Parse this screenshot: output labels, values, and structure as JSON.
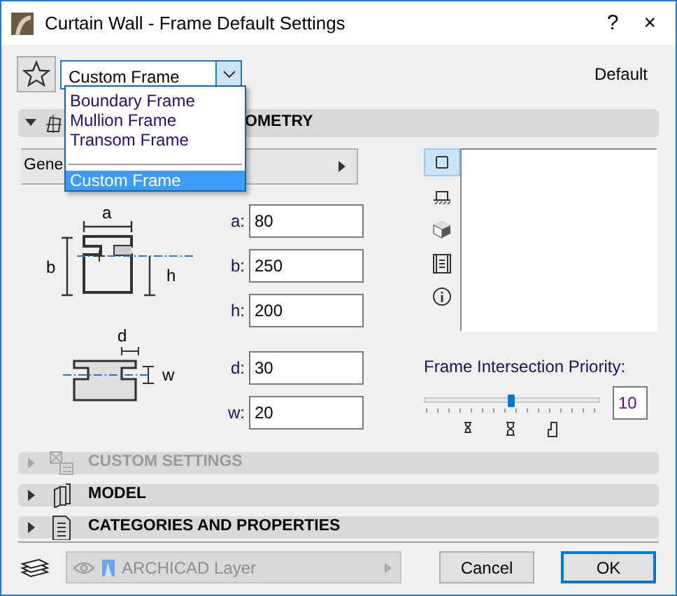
{
  "window": {
    "title": "Curtain Wall - Frame Default Settings",
    "help": "?",
    "close": "×"
  },
  "frame_type": {
    "value": "Custom Frame",
    "expanded": true,
    "options": [
      {
        "kind": "option",
        "label": "Boundary Frame",
        "selected": false
      },
      {
        "kind": "option",
        "label": "Mullion Frame",
        "selected": false
      },
      {
        "kind": "option",
        "label": "Transom Frame",
        "selected": false
      },
      {
        "kind": "separator"
      },
      {
        "kind": "option",
        "label": "Custom Frame",
        "selected": true
      }
    ]
  },
  "default_label": "Default",
  "sections": [
    {
      "kind": "geometry",
      "title": "OMETRY",
      "expanded": true,
      "disabled": false
    },
    {
      "kind": "custom",
      "title": "CUSTOM SETTINGS",
      "expanded": false,
      "disabled": true
    },
    {
      "kind": "model",
      "title": "MODEL",
      "expanded": false,
      "disabled": false
    },
    {
      "kind": "categories",
      "title": "CATEGORIES AND PROPERTIES",
      "expanded": false,
      "disabled": false
    }
  ],
  "geometry": {
    "profile_menu": "Gene",
    "diagram_labels": [
      "a",
      "b",
      "h",
      "d",
      "w"
    ],
    "fields": [
      {
        "label": "a:",
        "value": "80"
      },
      {
        "label": "b:",
        "value": "250"
      },
      {
        "label": "h:",
        "value": "200"
      },
      {
        "label": "d:",
        "value": "30"
      },
      {
        "label": "w:",
        "value": "20"
      }
    ],
    "view_tabs": [
      {
        "kind": "plan",
        "selected": true
      },
      {
        "kind": "section",
        "selected": false
      },
      {
        "kind": "cube",
        "selected": false
      },
      {
        "kind": "film",
        "selected": false
      },
      {
        "kind": "info",
        "selected": false
      }
    ],
    "priority": {
      "label": "Frame Intersection Priority:",
      "level": 0.5,
      "value": "10"
    }
  },
  "layer": {
    "value": "ARCHICAD Layer",
    "disabled": true
  },
  "buttons": [
    {
      "label": "Cancel",
      "default": false
    },
    {
      "label": "OK",
      "default": true
    }
  ]
}
